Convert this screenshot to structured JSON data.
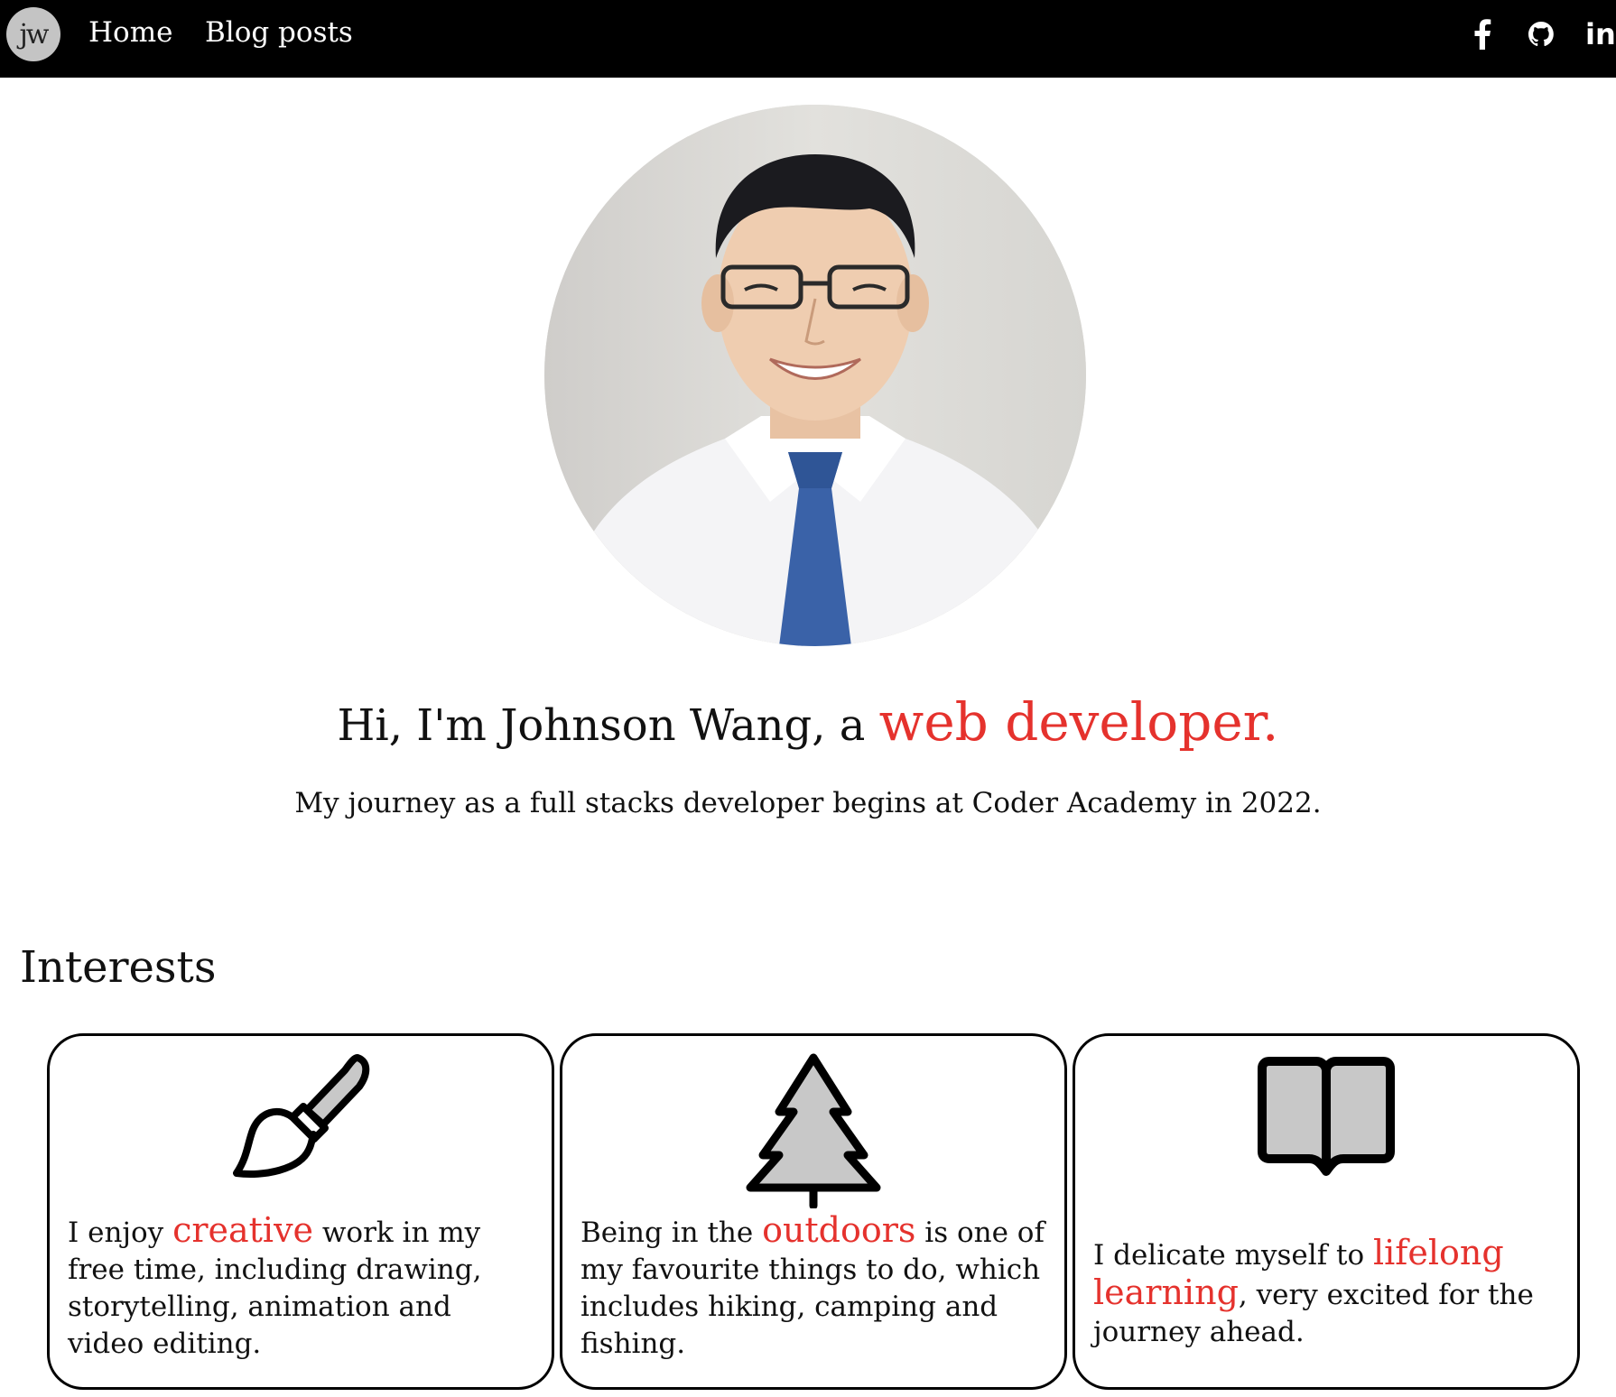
{
  "nav": {
    "logo_text": "jw",
    "links": [
      "Home",
      "Blog posts"
    ],
    "social_icons": [
      "facebook-icon",
      "github-icon",
      "linkedin-icon"
    ],
    "linkedin_text": "in"
  },
  "hero": {
    "headline_prefix": "Hi, I'm Johnson Wang, a ",
    "headline_accent": "web developer.",
    "subline": "My journey as a full stacks developer begins at Coder Academy in 2022."
  },
  "interests": {
    "title": "Interests",
    "cards": [
      {
        "icon": "paintbrush-icon",
        "before": "I enjoy ",
        "accent": "creative",
        "after": " work in my free time, including drawing, storytelling, animation and video editing."
      },
      {
        "icon": "tree-icon",
        "before": "Being in the ",
        "accent": "outdoors",
        "after": " is one of my favourite things to do, which includes hiking, camping and fishing."
      },
      {
        "icon": "book-icon",
        "before": "I delicate myself to ",
        "accent": "lifelong learning",
        "after": ", very excited for the journey ahead."
      }
    ]
  },
  "colors": {
    "accent": "#e5322d",
    "nav_background": "#000000",
    "icon_fill": "#c8c8c8"
  }
}
